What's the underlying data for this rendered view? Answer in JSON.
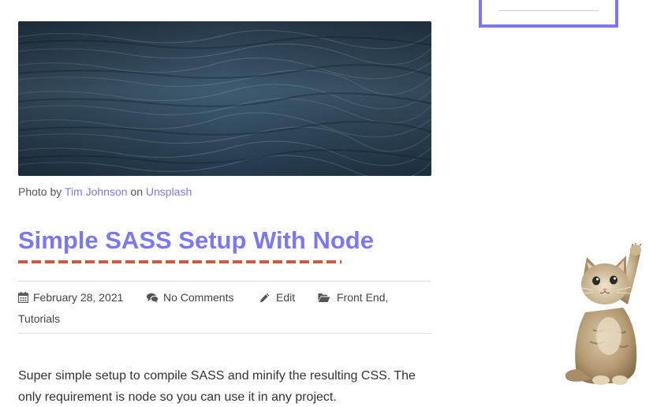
{
  "photo_credit": {
    "prefix": "Photo by",
    "author": "Tim Johnson",
    "middle": "on",
    "source": "Unsplash"
  },
  "post": {
    "title": "Simple SASS Setup With Node",
    "date": "February 28, 2021",
    "comments": "No Comments",
    "edit": "Edit",
    "category_1": "Front End,",
    "category_2": "Tutorials",
    "excerpt": "Super simple setup to compile SASS and minify the resulting CSS. The only requirement is node so you can use it in any project."
  },
  "colors": {
    "accent": "#7b78f1",
    "underline": "#c65a44",
    "water_dark": "#1e3445",
    "water_light": "#4d6b82"
  },
  "icons": {
    "date": "calendar-icon",
    "comments": "comments-icon",
    "edit": "pencil-icon",
    "categories": "folder-open-icon"
  }
}
